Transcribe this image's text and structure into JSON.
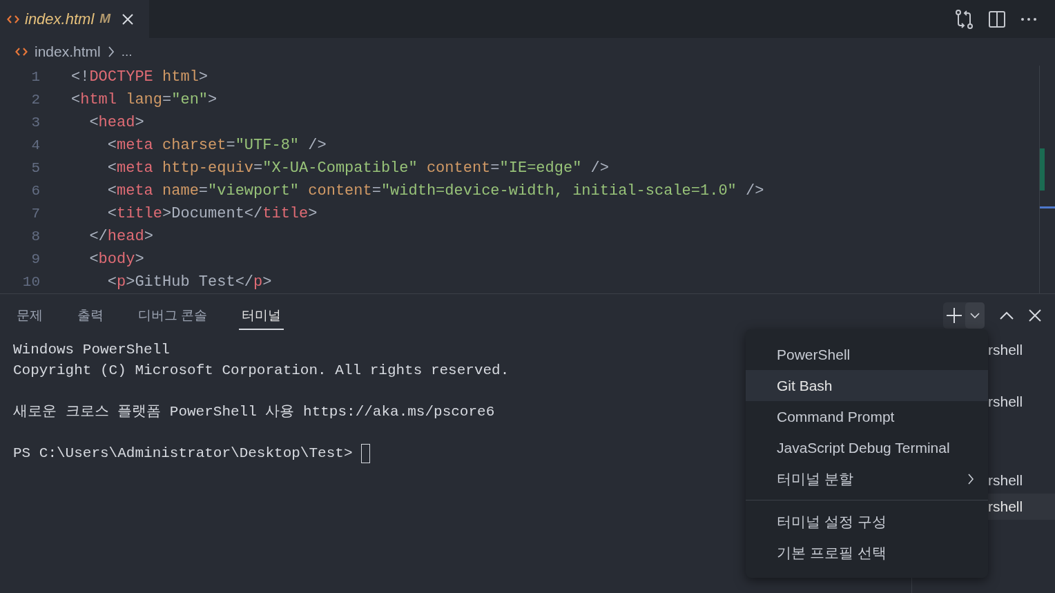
{
  "editor_tab": {
    "label": "index.html",
    "badge": "M"
  },
  "breadcrumb": {
    "file": "index.html",
    "more": "..."
  },
  "code_lines": [
    {
      "number": "1",
      "tokens": [
        {
          "kind": "punct",
          "text": "<!"
        },
        {
          "kind": "tag",
          "text": "DOCTYPE"
        },
        {
          "kind": "attr",
          "text": " html"
        },
        {
          "kind": "punct",
          "text": ">"
        }
      ]
    },
    {
      "number": "2",
      "tokens": [
        {
          "kind": "punct",
          "text": "<"
        },
        {
          "kind": "tag",
          "text": "html"
        },
        {
          "kind": "attr",
          "text": " lang"
        },
        {
          "kind": "punct",
          "text": "="
        },
        {
          "kind": "string",
          "text": "\"en\""
        },
        {
          "kind": "punct",
          "text": ">"
        }
      ]
    },
    {
      "number": "3",
      "tokens": [
        {
          "kind": "punct",
          "text": "  <"
        },
        {
          "kind": "tag",
          "text": "head"
        },
        {
          "kind": "punct",
          "text": ">"
        }
      ]
    },
    {
      "number": "4",
      "tokens": [
        {
          "kind": "punct",
          "text": "    <"
        },
        {
          "kind": "tag",
          "text": "meta"
        },
        {
          "kind": "attr",
          "text": " charset"
        },
        {
          "kind": "punct",
          "text": "="
        },
        {
          "kind": "string",
          "text": "\"UTF-8\""
        },
        {
          "kind": "punct",
          "text": " />"
        }
      ]
    },
    {
      "number": "5",
      "tokens": [
        {
          "kind": "punct",
          "text": "    <"
        },
        {
          "kind": "tag",
          "text": "meta"
        },
        {
          "kind": "attr",
          "text": " http-equiv"
        },
        {
          "kind": "punct",
          "text": "="
        },
        {
          "kind": "string",
          "text": "\"X-UA-Compatible\""
        },
        {
          "kind": "attr",
          "text": " content"
        },
        {
          "kind": "punct",
          "text": "="
        },
        {
          "kind": "string",
          "text": "\"IE=edge\""
        },
        {
          "kind": "punct",
          "text": " />"
        }
      ]
    },
    {
      "number": "6",
      "tokens": [
        {
          "kind": "punct",
          "text": "    <"
        },
        {
          "kind": "tag",
          "text": "meta"
        },
        {
          "kind": "attr",
          "text": " name"
        },
        {
          "kind": "punct",
          "text": "="
        },
        {
          "kind": "string",
          "text": "\"viewport\""
        },
        {
          "kind": "attr",
          "text": " content"
        },
        {
          "kind": "punct",
          "text": "="
        },
        {
          "kind": "string",
          "text": "\"width=device-width, initial-scale=1.0\""
        },
        {
          "kind": "punct",
          "text": " />"
        }
      ]
    },
    {
      "number": "7",
      "tokens": [
        {
          "kind": "punct",
          "text": "    <"
        },
        {
          "kind": "tag",
          "text": "title"
        },
        {
          "kind": "punct",
          "text": ">Document</"
        },
        {
          "kind": "tag",
          "text": "title"
        },
        {
          "kind": "punct",
          "text": ">"
        }
      ]
    },
    {
      "number": "8",
      "tokens": [
        {
          "kind": "punct",
          "text": "  </"
        },
        {
          "kind": "tag",
          "text": "head"
        },
        {
          "kind": "punct",
          "text": ">"
        }
      ]
    },
    {
      "number": "9",
      "tokens": [
        {
          "kind": "punct",
          "text": "  <"
        },
        {
          "kind": "tag",
          "text": "body"
        },
        {
          "kind": "punct",
          "text": ">"
        }
      ]
    },
    {
      "number": "10",
      "tokens": [
        {
          "kind": "punct",
          "text": "    <"
        },
        {
          "kind": "tag",
          "text": "p"
        },
        {
          "kind": "punct",
          "text": ">GitHub Test</"
        },
        {
          "kind": "tag",
          "text": "p"
        },
        {
          "kind": "punct",
          "text": ">"
        }
      ]
    }
  ],
  "panel_tabs": [
    {
      "label": "문제",
      "selected": false
    },
    {
      "label": "출력",
      "selected": false
    },
    {
      "label": "디버그 콘솔",
      "selected": false
    },
    {
      "label": "터미널",
      "selected": true
    }
  ],
  "terminal_blocks": [
    [
      "Windows PowerShell",
      "Copyright (C) Microsoft Corporation. All rights reserved."
    ],
    [
      "새로운 크로스 플랫폼 PowerShell 사용 https://aka.ms/pscore6"
    ],
    [
      "PS C:\\Users\\Administrator\\Desktop\\Test> "
    ]
  ],
  "terminal_list": [
    {
      "label": "rshell",
      "selected": false
    },
    {
      "label": "rshell",
      "selected": false
    },
    {
      "label": "rshell",
      "selected": false
    },
    {
      "label": "rshell",
      "selected": true
    }
  ],
  "menu": {
    "groups": [
      [
        {
          "label": "PowerShell",
          "kind": "item",
          "selected": false
        },
        {
          "label": "Git Bash",
          "kind": "item",
          "selected": true
        },
        {
          "label": "Command Prompt",
          "kind": "item",
          "selected": false
        },
        {
          "label": "JavaScript Debug Terminal",
          "kind": "item",
          "selected": false
        },
        {
          "label": "터미널 분할",
          "kind": "submenu",
          "selected": false
        }
      ],
      [
        {
          "label": "터미널 설정 구성",
          "kind": "item",
          "selected": false
        },
        {
          "label": "기본 프로필 선택",
          "kind": "item",
          "selected": false
        }
      ]
    ]
  }
}
